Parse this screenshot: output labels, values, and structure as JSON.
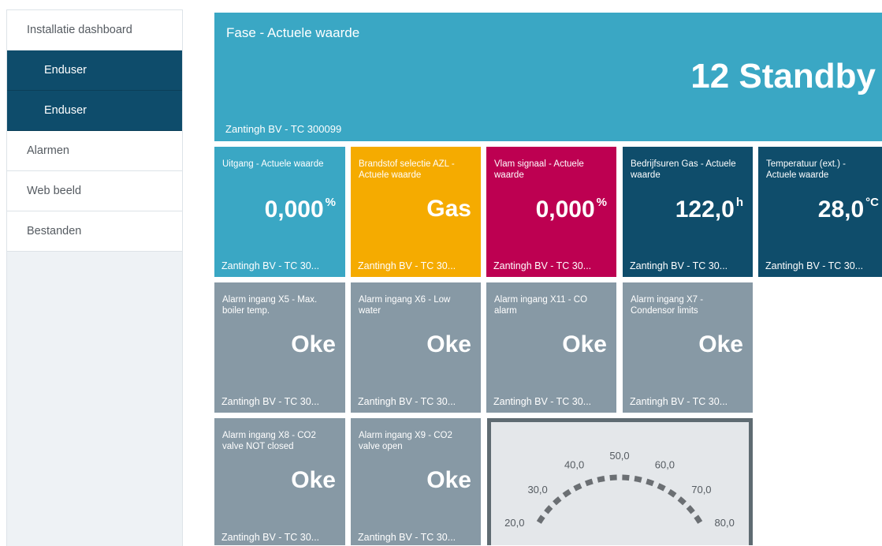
{
  "sidebar": {
    "items": [
      {
        "label": "Installatie dashboard"
      },
      {
        "label": "Enduser"
      },
      {
        "label": "Enduser"
      },
      {
        "label": "Alarmen"
      },
      {
        "label": "Web beeld"
      },
      {
        "label": "Bestanden"
      }
    ]
  },
  "main_tile": {
    "title": "Fase - Actuele waarde",
    "value": "12 Standby",
    "footer": "Zantingh BV - TC 300099"
  },
  "tiles_row1": [
    {
      "title": "Uitgang - Actuele waarde",
      "value": "0,000",
      "unit": "%",
      "footer": "Zantingh BV - TC 30...",
      "color": "#3aa7c4"
    },
    {
      "title": "Brandstof selectie AZL - Actuele waarde",
      "value": "Gas",
      "unit": "",
      "footer": "Zantingh BV - TC 30...",
      "color": "#f5ab00"
    },
    {
      "title": "Vlam signaal - Actuele waarde",
      "value": "0,000",
      "unit": "%",
      "footer": "Zantingh BV - TC 30...",
      "color": "#bd0051"
    },
    {
      "title": "Bedrijfsuren Gas - Actuele waarde",
      "value": "122,0",
      "unit": "h",
      "footer": "Zantingh BV - TC 30...",
      "color": "#0f4d6b"
    },
    {
      "title": "Temperatuur (ext.) - Actuele waarde",
      "value": "28,0",
      "unit": "°C",
      "footer": "Zantingh BV - TC 30...",
      "color": "#0f4d6b"
    }
  ],
  "tiles_row2": [
    {
      "title": "Alarm ingang X5 - Max. boiler temp.",
      "value": "Oke",
      "footer": "Zantingh BV - TC 30..."
    },
    {
      "title": "Alarm ingang X6 - Low water",
      "value": "Oke",
      "footer": "Zantingh BV - TC 30..."
    },
    {
      "title": "Alarm ingang X11 - CO alarm",
      "value": "Oke",
      "footer": "Zantingh BV - TC 30..."
    },
    {
      "title": "Alarm ingang X7 - Condensor limits",
      "value": "Oke",
      "footer": "Zantingh BV - TC 30..."
    }
  ],
  "tiles_row3": [
    {
      "title": "Alarm ingang X8 - CO2 valve NOT closed",
      "value": "Oke",
      "footer": "Zantingh BV - TC 30..."
    },
    {
      "title": "Alarm ingang X9 - CO2 valve open",
      "value": "Oke",
      "footer": "Zantingh BV - TC 30..."
    }
  ],
  "gauge": {
    "tick_labels": [
      "20,0",
      "30,0",
      "40,0",
      "50,0",
      "60,0",
      "70,0",
      "80,0"
    ]
  }
}
